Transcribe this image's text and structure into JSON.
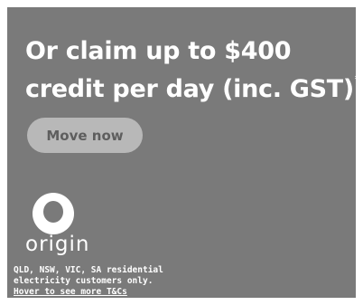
{
  "ad": {
    "headline_line1": "Or claim up to $400",
    "headline_line2": "credit per day (inc. GST)",
    "headline_footnote_mark": "*",
    "cta_label": "Move now",
    "brand_word": "origin",
    "disclaimer_line1": "QLD, NSW, VIC, SA residential",
    "disclaimer_line2": "electricity customers only.",
    "tcs_link": "Hover to see more T&Cs"
  },
  "colors": {
    "background": "#7a7a7a",
    "text": "#ffffff",
    "button_fill": "#b8b8b8",
    "button_text": "#5e5e5e"
  },
  "icons": {
    "logo": "origin-logo-icon"
  }
}
